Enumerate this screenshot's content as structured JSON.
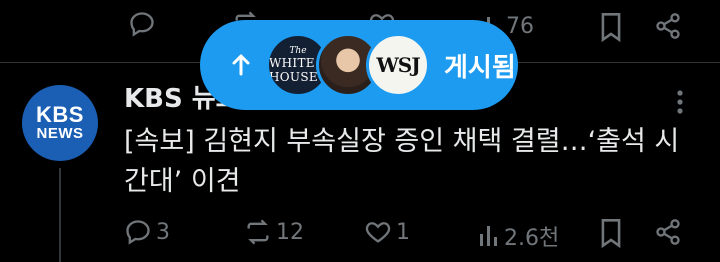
{
  "top_post": {
    "views_count": "76",
    "icons": [
      "reply-icon",
      "repost-icon",
      "like-icon",
      "views-icon",
      "bookmark-icon",
      "share-icon"
    ]
  },
  "new_posts_pill": {
    "label": "게시됨",
    "avatars": [
      {
        "name": "white-house",
        "logo_text_small": "The",
        "logo_text": "WHITE HOUSE"
      },
      {
        "name": "person-photo"
      },
      {
        "name": "wsj",
        "logo_text": "WSJ"
      }
    ],
    "icon": "arrow-up-icon"
  },
  "post": {
    "avatar_line1": "KBS",
    "avatar_line2": "NEWS",
    "author": "KBS 뉴스",
    "text": "[속보] 김현지 부속실장 증인 채택 결렬…‘출석 시간대’ 이견",
    "reply_count": "3",
    "repost_count": "12",
    "like_count": "1",
    "views_count": "2.6천"
  },
  "colors": {
    "background": "#000000",
    "accent": "#1d9bf0",
    "text_primary": "#e7e9ea",
    "text_secondary": "#71767b",
    "kbs_blue": "#1a5fb4"
  }
}
